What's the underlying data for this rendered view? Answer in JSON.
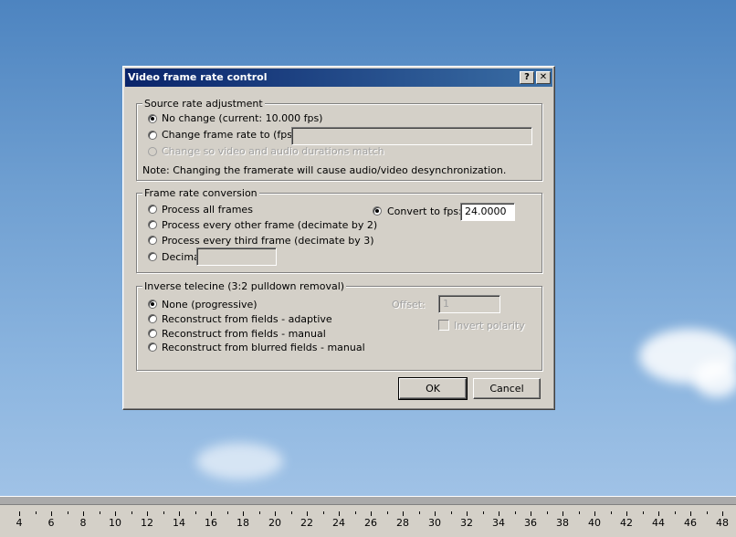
{
  "dialog": {
    "title": "Video frame rate control",
    "help_button": "?",
    "close_button": "✕",
    "source": {
      "legend": "Source rate adjustment",
      "no_change": "No change (current: 10.000 fps)",
      "change_to": "Change frame rate to (fps):",
      "change_to_value": "",
      "match_durations": "Change so video and audio durations match",
      "note": "Note: Changing the framerate will cause audio/video desynchronization."
    },
    "conversion": {
      "legend": "Frame rate conversion",
      "all_frames": "Process all frames",
      "every_other": "Process every other frame (decimate by 2)",
      "every_third": "Process every third frame (decimate by 3)",
      "decimate_by": "Decimate by",
      "decimate_value": "",
      "convert_to": "Convert to fps:",
      "convert_value": "24.0000"
    },
    "telecine": {
      "legend": "Inverse telecine (3:2 pulldown removal)",
      "none": "None (progressive)",
      "adaptive": "Reconstruct from fields - adaptive",
      "manual": "Reconstruct from fields - manual",
      "blurred_manual": "Reconstruct from blurred fields - manual",
      "offset_label": "Offset:",
      "offset_value": "1",
      "invert_polarity": "Invert polarity"
    },
    "ok_label": "OK",
    "cancel_label": "Cancel"
  },
  "timeline": {
    "ticks": [
      "4",
      "6",
      "8",
      "10",
      "12",
      "14",
      "16",
      "18",
      "20",
      "22",
      "24",
      "26",
      "28",
      "30",
      "32",
      "34",
      "36",
      "38",
      "40",
      "42",
      "44",
      "46",
      "48"
    ]
  }
}
